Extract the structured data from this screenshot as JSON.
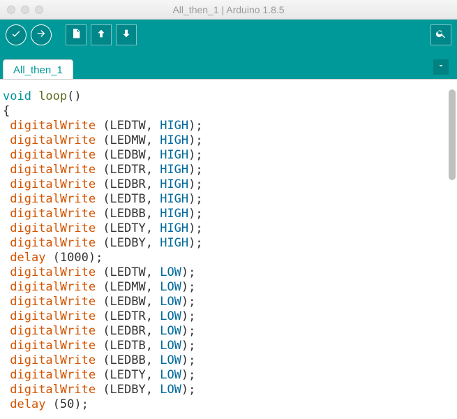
{
  "window": {
    "title": "All_then_1 | Arduino 1.8.5"
  },
  "toolbar": {
    "verify_tip": "Verify",
    "upload_tip": "Upload",
    "new_tip": "New",
    "open_tip": "Open",
    "save_tip": "Save",
    "serial_tip": "Serial Monitor"
  },
  "tabs": {
    "active": "All_then_1"
  },
  "code": {
    "lines": [
      {
        "tokens": [
          {
            "t": "void ",
            "c": "kw-type"
          },
          {
            "t": "loop",
            "c": "kw-func"
          },
          {
            "t": "()",
            "c": "pn"
          }
        ]
      },
      {
        "tokens": [
          {
            "t": "{",
            "c": "pn"
          }
        ]
      },
      {
        "tokens": [
          {
            "t": " ",
            "c": "pn"
          },
          {
            "t": "digitalWrite",
            "c": "kw-call"
          },
          {
            "t": " (LEDTW, ",
            "c": "pn"
          },
          {
            "t": "HIGH",
            "c": "kw-const"
          },
          {
            "t": ");",
            "c": "pn"
          }
        ]
      },
      {
        "tokens": [
          {
            "t": " ",
            "c": "pn"
          },
          {
            "t": "digitalWrite",
            "c": "kw-call"
          },
          {
            "t": " (LEDMW, ",
            "c": "pn"
          },
          {
            "t": "HIGH",
            "c": "kw-const"
          },
          {
            "t": ");",
            "c": "pn"
          }
        ]
      },
      {
        "tokens": [
          {
            "t": " ",
            "c": "pn"
          },
          {
            "t": "digitalWrite",
            "c": "kw-call"
          },
          {
            "t": " (LEDBW, ",
            "c": "pn"
          },
          {
            "t": "HIGH",
            "c": "kw-const"
          },
          {
            "t": ");",
            "c": "pn"
          }
        ]
      },
      {
        "tokens": [
          {
            "t": " ",
            "c": "pn"
          },
          {
            "t": "digitalWrite",
            "c": "kw-call"
          },
          {
            "t": " (LEDTR, ",
            "c": "pn"
          },
          {
            "t": "HIGH",
            "c": "kw-const"
          },
          {
            "t": ");",
            "c": "pn"
          }
        ]
      },
      {
        "tokens": [
          {
            "t": " ",
            "c": "pn"
          },
          {
            "t": "digitalWrite",
            "c": "kw-call"
          },
          {
            "t": " (LEDBR, ",
            "c": "pn"
          },
          {
            "t": "HIGH",
            "c": "kw-const"
          },
          {
            "t": ");",
            "c": "pn"
          }
        ]
      },
      {
        "tokens": [
          {
            "t": " ",
            "c": "pn"
          },
          {
            "t": "digitalWrite",
            "c": "kw-call"
          },
          {
            "t": " (LEDTB, ",
            "c": "pn"
          },
          {
            "t": "HIGH",
            "c": "kw-const"
          },
          {
            "t": ");",
            "c": "pn"
          }
        ]
      },
      {
        "tokens": [
          {
            "t": " ",
            "c": "pn"
          },
          {
            "t": "digitalWrite",
            "c": "kw-call"
          },
          {
            "t": " (LEDBB, ",
            "c": "pn"
          },
          {
            "t": "HIGH",
            "c": "kw-const"
          },
          {
            "t": ");",
            "c": "pn"
          }
        ]
      },
      {
        "tokens": [
          {
            "t": " ",
            "c": "pn"
          },
          {
            "t": "digitalWrite",
            "c": "kw-call"
          },
          {
            "t": " (LEDTY, ",
            "c": "pn"
          },
          {
            "t": "HIGH",
            "c": "kw-const"
          },
          {
            "t": ");",
            "c": "pn"
          }
        ]
      },
      {
        "tokens": [
          {
            "t": " ",
            "c": "pn"
          },
          {
            "t": "digitalWrite",
            "c": "kw-call"
          },
          {
            "t": " (LEDBY, ",
            "c": "pn"
          },
          {
            "t": "HIGH",
            "c": "kw-const"
          },
          {
            "t": ");",
            "c": "pn"
          }
        ]
      },
      {
        "tokens": [
          {
            "t": " ",
            "c": "pn"
          },
          {
            "t": "delay",
            "c": "kw-call"
          },
          {
            "t": " (1000);",
            "c": "pn"
          }
        ]
      },
      {
        "tokens": [
          {
            "t": " ",
            "c": "pn"
          },
          {
            "t": "digitalWrite",
            "c": "kw-call"
          },
          {
            "t": " (LEDTW, ",
            "c": "pn"
          },
          {
            "t": "LOW",
            "c": "kw-const"
          },
          {
            "t": ");",
            "c": "pn"
          }
        ]
      },
      {
        "tokens": [
          {
            "t": " ",
            "c": "pn"
          },
          {
            "t": "digitalWrite",
            "c": "kw-call"
          },
          {
            "t": " (LEDMW, ",
            "c": "pn"
          },
          {
            "t": "LOW",
            "c": "kw-const"
          },
          {
            "t": ");",
            "c": "pn"
          }
        ]
      },
      {
        "tokens": [
          {
            "t": " ",
            "c": "pn"
          },
          {
            "t": "digitalWrite",
            "c": "kw-call"
          },
          {
            "t": " (LEDBW, ",
            "c": "pn"
          },
          {
            "t": "LOW",
            "c": "kw-const"
          },
          {
            "t": ");",
            "c": "pn"
          }
        ]
      },
      {
        "tokens": [
          {
            "t": " ",
            "c": "pn"
          },
          {
            "t": "digitalWrite",
            "c": "kw-call"
          },
          {
            "t": " (LEDTR, ",
            "c": "pn"
          },
          {
            "t": "LOW",
            "c": "kw-const"
          },
          {
            "t": ");",
            "c": "pn"
          }
        ]
      },
      {
        "tokens": [
          {
            "t": " ",
            "c": "pn"
          },
          {
            "t": "digitalWrite",
            "c": "kw-call"
          },
          {
            "t": " (LEDBR, ",
            "c": "pn"
          },
          {
            "t": "LOW",
            "c": "kw-const"
          },
          {
            "t": ");",
            "c": "pn"
          }
        ]
      },
      {
        "tokens": [
          {
            "t": " ",
            "c": "pn"
          },
          {
            "t": "digitalWrite",
            "c": "kw-call"
          },
          {
            "t": " (LEDTB, ",
            "c": "pn"
          },
          {
            "t": "LOW",
            "c": "kw-const"
          },
          {
            "t": ");",
            "c": "pn"
          }
        ]
      },
      {
        "tokens": [
          {
            "t": " ",
            "c": "pn"
          },
          {
            "t": "digitalWrite",
            "c": "kw-call"
          },
          {
            "t": " (LEDBB, ",
            "c": "pn"
          },
          {
            "t": "LOW",
            "c": "kw-const"
          },
          {
            "t": ");",
            "c": "pn"
          }
        ]
      },
      {
        "tokens": [
          {
            "t": " ",
            "c": "pn"
          },
          {
            "t": "digitalWrite",
            "c": "kw-call"
          },
          {
            "t": " (LEDTY, ",
            "c": "pn"
          },
          {
            "t": "LOW",
            "c": "kw-const"
          },
          {
            "t": ");",
            "c": "pn"
          }
        ]
      },
      {
        "tokens": [
          {
            "t": " ",
            "c": "pn"
          },
          {
            "t": "digitalWrite",
            "c": "kw-call"
          },
          {
            "t": " (LEDBY, ",
            "c": "pn"
          },
          {
            "t": "LOW",
            "c": "kw-const"
          },
          {
            "t": ");",
            "c": "pn"
          }
        ]
      },
      {
        "tokens": [
          {
            "t": " ",
            "c": "pn"
          },
          {
            "t": "delay",
            "c": "kw-call"
          },
          {
            "t": " (50);",
            "c": "pn"
          }
        ]
      }
    ]
  }
}
